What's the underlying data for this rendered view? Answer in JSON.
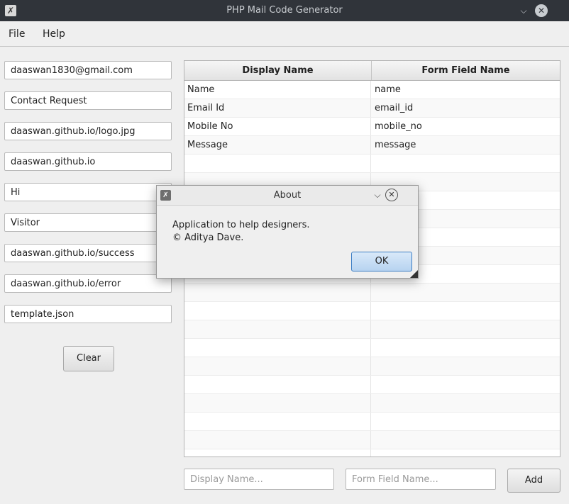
{
  "window": {
    "title": "PHP Mail Code Generator"
  },
  "menu": {
    "file": "File",
    "help": "Help"
  },
  "fields": [
    "daaswan1830@gmail.com",
    "Contact Request",
    "daaswan.github.io/logo.jpg",
    "daaswan.github.io",
    "Hi",
    "Visitor",
    "daaswan.github.io/success",
    "daaswan.github.io/error",
    "template.json"
  ],
  "clear_label": "Clear",
  "table": {
    "headers": [
      "Display Name",
      "Form Field Name"
    ],
    "rows": [
      [
        "Name",
        "name"
      ],
      [
        "Email Id",
        "email_id"
      ],
      [
        "Mobile No",
        "mobile_no"
      ],
      [
        "Message",
        "message"
      ]
    ]
  },
  "inputs": {
    "display_placeholder": "Display Name...",
    "field_placeholder": "Form Field Name...",
    "add_label": "Add"
  },
  "dialog": {
    "title": "About",
    "line1": "Application to help designers.",
    "line2": "© Aditya Dave.",
    "ok_label": "OK"
  },
  "icons": {
    "app": "app-logo-icon",
    "minimize": "chevron-down-icon",
    "close": "close-icon"
  }
}
